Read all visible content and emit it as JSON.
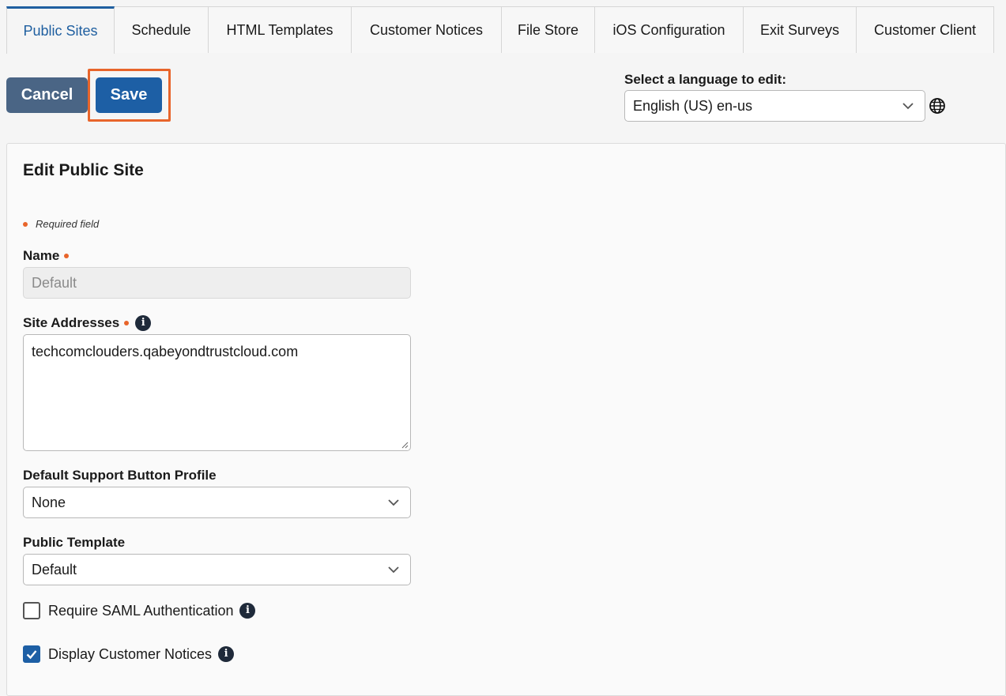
{
  "tabs": [
    {
      "label": "Public Sites",
      "active": true
    },
    {
      "label": "Schedule"
    },
    {
      "label": "HTML Templates"
    },
    {
      "label": "Customer Notices"
    },
    {
      "label": "File Store"
    },
    {
      "label": "iOS Configuration"
    },
    {
      "label": "Exit Surveys"
    },
    {
      "label": "Customer Client"
    }
  ],
  "toolbar": {
    "cancel_label": "Cancel",
    "save_label": "Save",
    "language_label": "Select a language to edit:",
    "language_value": "English (US) en-us"
  },
  "form": {
    "title": "Edit Public Site",
    "required_note": "Required field",
    "name_label": "Name",
    "name_value": "Default",
    "site_addresses_label": "Site Addresses",
    "site_addresses_value": "techcomclouders.qabeyondtrustcloud.com",
    "support_profile_label": "Default Support Button Profile",
    "support_profile_value": "None",
    "public_template_label": "Public Template",
    "public_template_value": "Default",
    "saml_label": "Require SAML Authentication",
    "saml_checked": false,
    "notices_label": "Display Customer Notices",
    "notices_checked": true
  },
  "colors": {
    "accent": "#1d5fa5",
    "cancel": "#4a6585",
    "required": "#e8652b",
    "highlight": "#e8652b"
  },
  "icons": [
    "chevron-down-icon",
    "globe-icon",
    "info-icon",
    "check-icon"
  ]
}
